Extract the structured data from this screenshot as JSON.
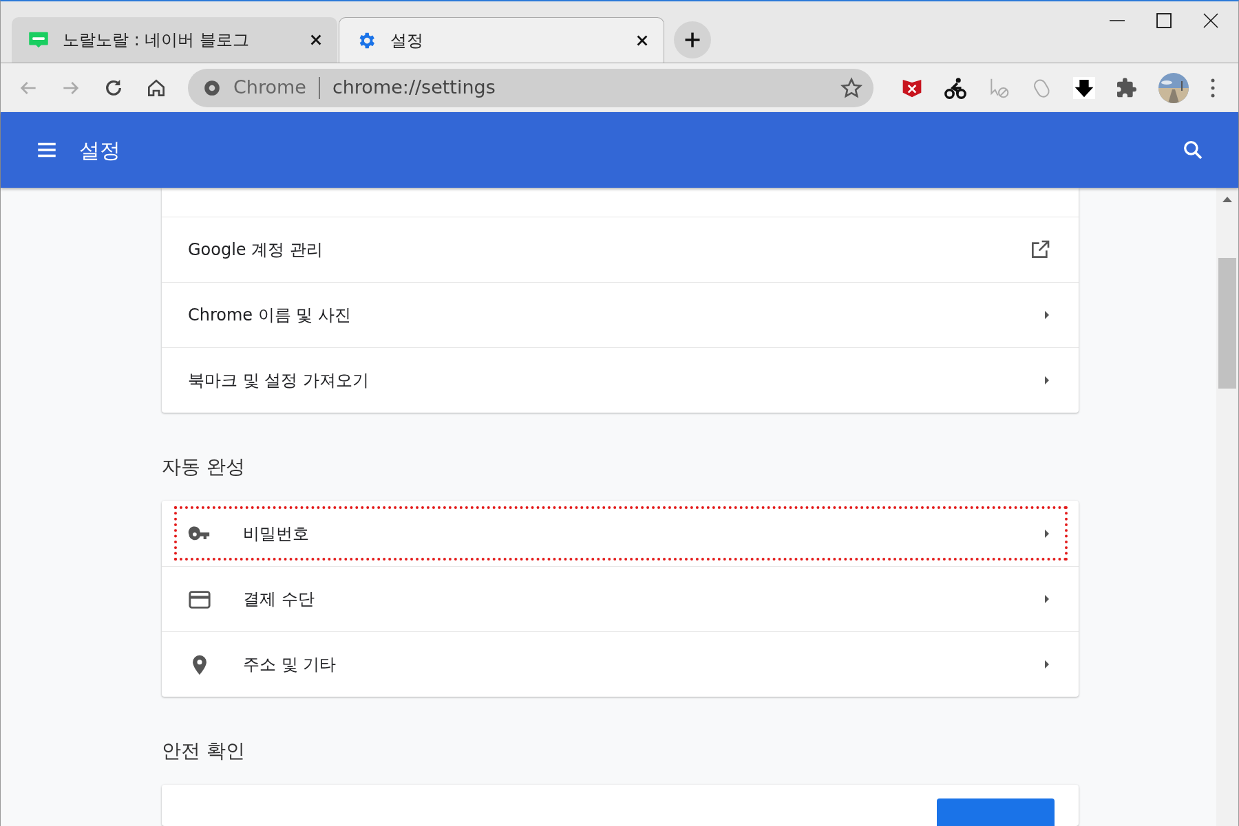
{
  "tabs": [
    {
      "title": "노랄노랄 : 네이버 블로그",
      "selected": false
    },
    {
      "title": "설정",
      "selected": true
    }
  ],
  "address_bar": {
    "site_label": "Chrome",
    "url": "chrome://settings"
  },
  "header": {
    "title": "설정"
  },
  "sections": [
    {
      "items": [
        {
          "label": "Google 계정 관리",
          "kind": "external"
        },
        {
          "label": "Chrome 이름 및 사진",
          "kind": "arrow"
        },
        {
          "label": "북마크 및 설정 가져오기",
          "kind": "arrow"
        }
      ]
    },
    {
      "heading": "자동 완성",
      "items": [
        {
          "label": "비밀번호",
          "kind": "arrow",
          "highlighted": true
        },
        {
          "label": "결제 수단",
          "kind": "arrow",
          "highlighted": false
        },
        {
          "label": "주소 및 기타",
          "kind": "arrow",
          "highlighted": false
        }
      ]
    },
    {
      "heading": "안전 확인"
    }
  ]
}
